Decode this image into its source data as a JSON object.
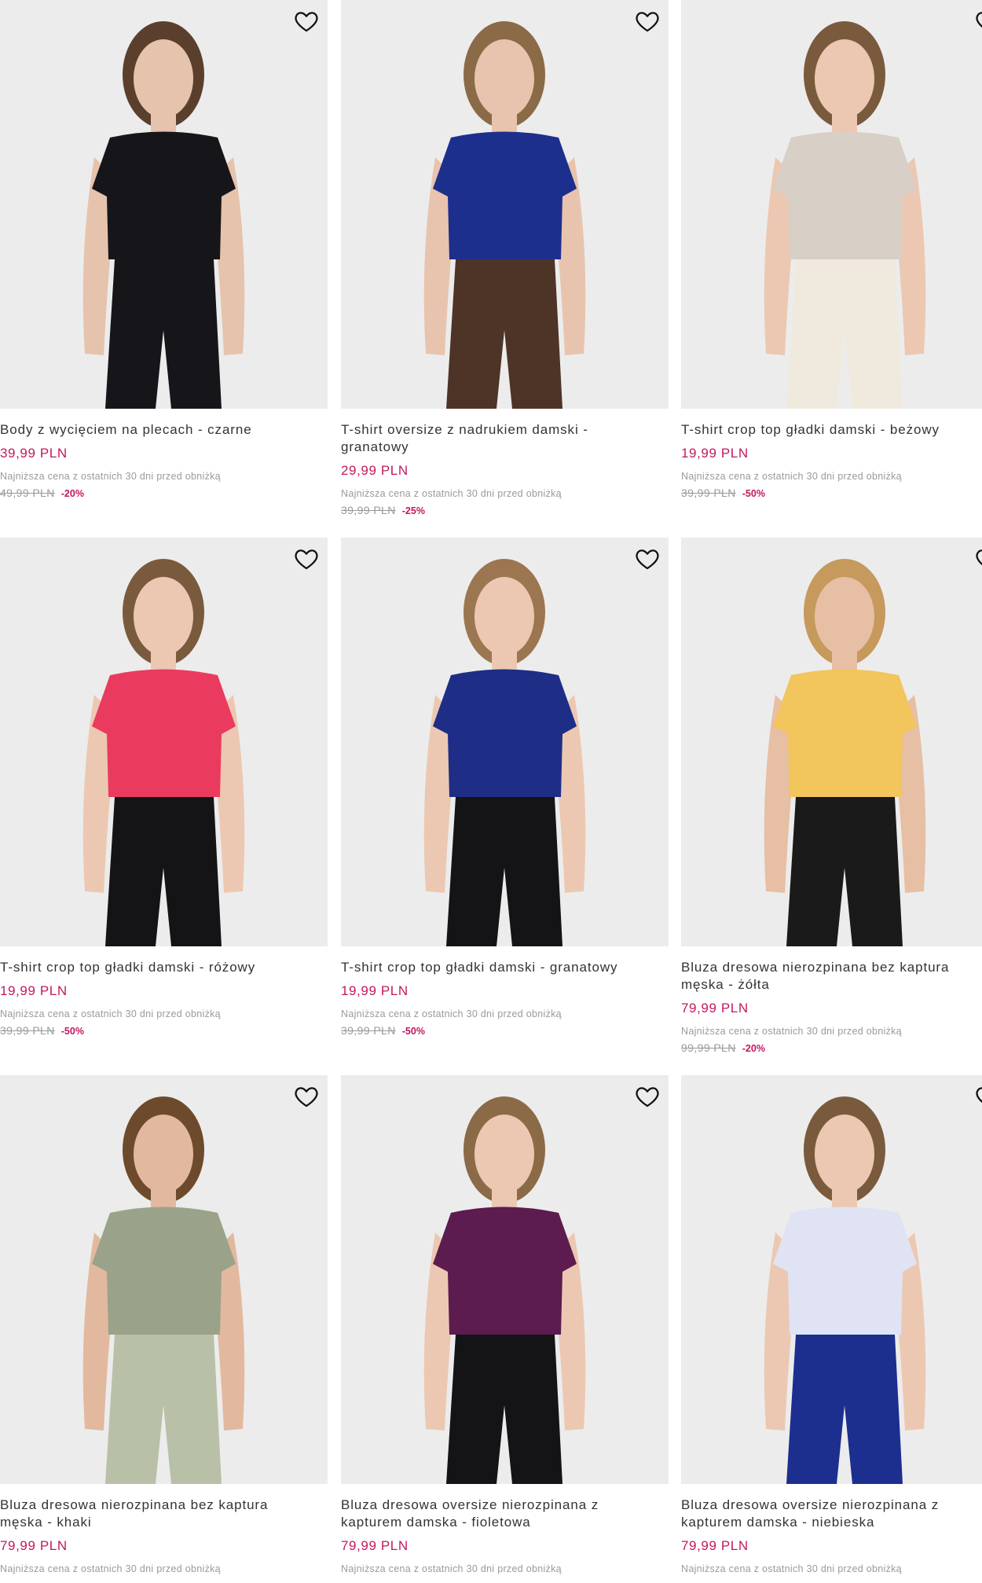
{
  "lowest_label": "Najniższa cena z ostatnich 30 dni przed obniżką",
  "products": [
    {
      "name": "Body z wycięciem na plecach - czarne",
      "price": "39,99 PLN",
      "old_price": "49,99 PLN",
      "discount": "-20%",
      "colors": {
        "top": "#16161a",
        "bottom": "#16161a",
        "skin": "#e6c3ad",
        "hair": "#5b3f2d"
      }
    },
    {
      "name": "T-shirt oversize z nadrukiem damski - granatowy",
      "price": "29,99 PLN",
      "old_price": "39,99 PLN",
      "discount": "-25%",
      "colors": {
        "top": "#1d2f8c",
        "bottom": "#4e3327",
        "skin": "#e8c4ae",
        "hair": "#8b6a47"
      }
    },
    {
      "name": "T-shirt crop top gładki damski - beżowy",
      "price": "19,99 PLN",
      "old_price": "39,99 PLN",
      "discount": "-50%",
      "colors": {
        "top": "#d8cfc6",
        "bottom": "#efeadd",
        "skin": "#ecc8b2",
        "hair": "#7a5a3c"
      }
    },
    {
      "name": "T-shirt crop top gładki damski - różowy",
      "price": "19,99 PLN",
      "old_price": "39,99 PLN",
      "discount": "-50%",
      "colors": {
        "top": "#ea3b5f",
        "bottom": "#141417",
        "skin": "#ecc8b2",
        "hair": "#7a5a3c"
      }
    },
    {
      "name": "T-shirt crop top gładki damski - granatowy",
      "price": "19,99 PLN",
      "old_price": "39,99 PLN",
      "discount": "-50%",
      "colors": {
        "top": "#1e2e86",
        "bottom": "#141417",
        "skin": "#ecc8b2",
        "hair": "#9c7650"
      }
    },
    {
      "name": "Bluza dresowa nierozpinana bez kaptura męska - żółta",
      "price": "79,99 PLN",
      "old_price": "99,99 PLN",
      "discount": "-20%",
      "colors": {
        "top": "#f2c55d",
        "bottom": "#1a1a1a",
        "skin": "#e6bfa4",
        "hair": "#c59a5c"
      }
    },
    {
      "name": "Bluza dresowa nierozpinana bez kaptura męska - khaki",
      "price": "79,99 PLN",
      "old_price": "",
      "discount": "",
      "colors": {
        "top": "#9aa38a",
        "bottom": "#b9c0a8",
        "skin": "#e2b99e",
        "hair": "#6d4a2c"
      }
    },
    {
      "name": "Bluza dresowa oversize nierozpinana z kapturem damska - fioletowa",
      "price": "79,99 PLN",
      "old_price": "",
      "discount": "",
      "colors": {
        "top": "#5c1c4f",
        "bottom": "#141417",
        "skin": "#ecc8b2",
        "hair": "#8b6a47"
      }
    },
    {
      "name": "Bluza dresowa oversize nierozpinana z kapturem damska - niebieska",
      "price": "79,99 PLN",
      "old_price": "",
      "discount": "",
      "colors": {
        "top": "#dfe3f3",
        "bottom": "#1c2f8f",
        "skin": "#ecc8b2",
        "hair": "#7a5a3c"
      }
    }
  ]
}
